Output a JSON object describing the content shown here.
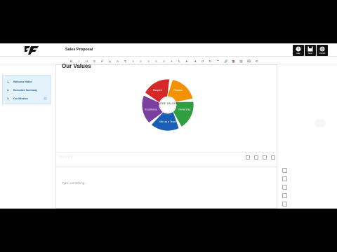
{
  "header": {
    "doc_title": "Sales Proposal",
    "buttons": [
      {
        "label": "Help",
        "icon": "help-icon"
      },
      {
        "label": "Save",
        "icon": "save-icon"
      },
      {
        "label": "Publish",
        "icon": "publish-icon"
      }
    ]
  },
  "toolbar": {
    "items": [
      "B",
      "I",
      "U",
      "S",
      "x²",
      "x₂",
      "A",
      "¶",
      "≡",
      "≡",
      "≡",
      "≡",
      "≡",
      "•",
      "1.",
      "⇤",
      "⇥",
      "↺",
      "↻",
      "❝",
      "🔗",
      "▦",
      "▤",
      "⌧",
      "⟲"
    ]
  },
  "sidebar": {
    "items": [
      {
        "num": "1.",
        "label": "Welcome Video"
      },
      {
        "num": "2.",
        "label": "Executive Summary"
      },
      {
        "num": "3.",
        "label": "Our Mission"
      }
    ]
  },
  "main": {
    "heading": "Our Values",
    "wheel_center": "CORE VALUES",
    "wheel_segments": [
      {
        "label": "Passion",
        "color": "#f39200"
      },
      {
        "label": "Ownership",
        "color": "#2e9e3f"
      },
      {
        "label": "Win as a Team",
        "color": "#1a5fb4"
      },
      {
        "label": "Excellence",
        "color": "#7b3fa0"
      },
      {
        "label": "Respect",
        "color": "#d62828"
      }
    ],
    "placeholder": "Type something..."
  }
}
